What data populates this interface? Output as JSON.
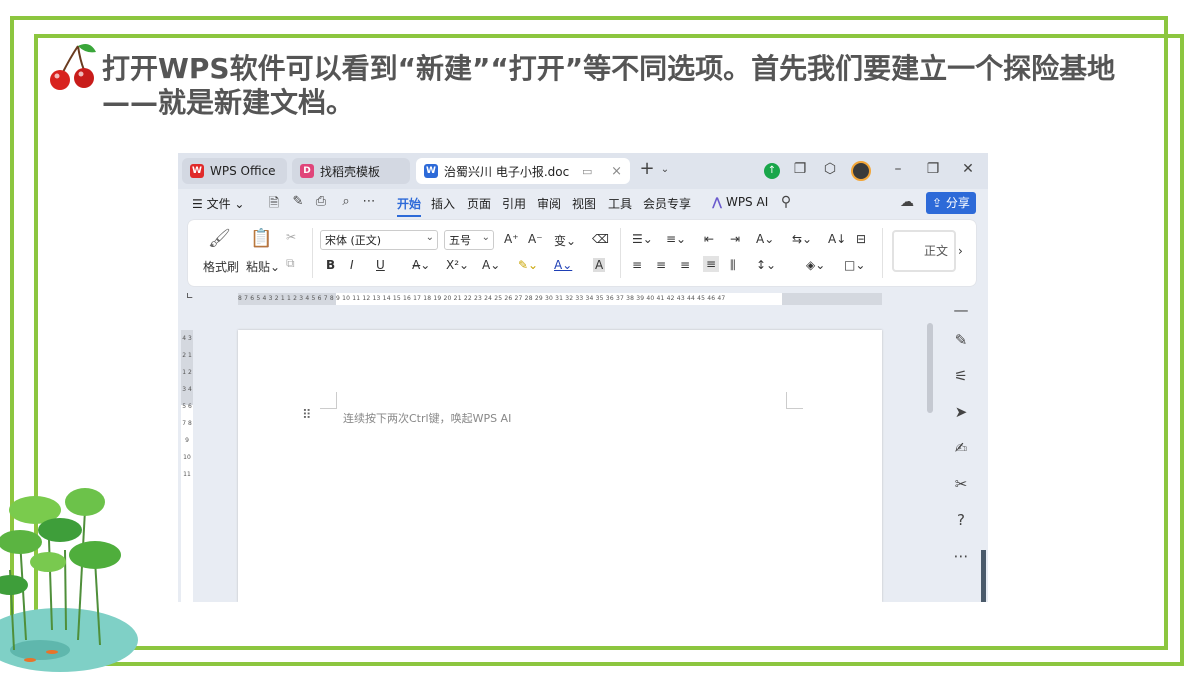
{
  "slide": {
    "title": "打开WPS软件可以看到“新建”“打开”等不同选项。首先我们要建立一个探险基地——就是新建文档。"
  },
  "window": {
    "tabs": [
      {
        "label": "WPS Office",
        "icon": "wps-logo-icon",
        "color": "#e02a2a"
      },
      {
        "label": "找稻壳模板",
        "icon": "docer-logo-icon",
        "color": "#e0457a"
      },
      {
        "label": "治蜀兴川 电子小报.doc",
        "icon": "word-doc-icon",
        "color": "#2d6ad8"
      }
    ],
    "new_tab_symbol": "+",
    "menu": {
      "file": "文件",
      "items": [
        "开始",
        "插入",
        "页面",
        "引用",
        "审阅",
        "视图",
        "工具",
        "会员专享"
      ],
      "active": "开始",
      "wps_ai": "WPS AI",
      "share": "分享"
    },
    "ribbon": {
      "format_painter": "格式刷",
      "paste": "粘贴",
      "font_name": "宋体 (正文)",
      "font_size": "五号",
      "bold": "B",
      "italic": "I",
      "underline": "U",
      "style_preview": "正文"
    },
    "ruler_text": "8 7 6 5 4 3 2 1 1 2 3 4 5 6 7 8 9 10 11 12 13 14 15 16 17 18 19 20 21 22 23 24 25 26 27 28 29 30 31 32 33 34 35 36 37 38 39 40 41 42 43 44 45 46 47",
    "vruler_text": "4 3 2 1 1 2 3 4 5 6 7 8 9 10 11",
    "document": {
      "hint": "连续按下两次Ctrl键，唤起WPS AI"
    },
    "accent_color": "#2d6ad8",
    "frame_color": "#8cc63f"
  }
}
